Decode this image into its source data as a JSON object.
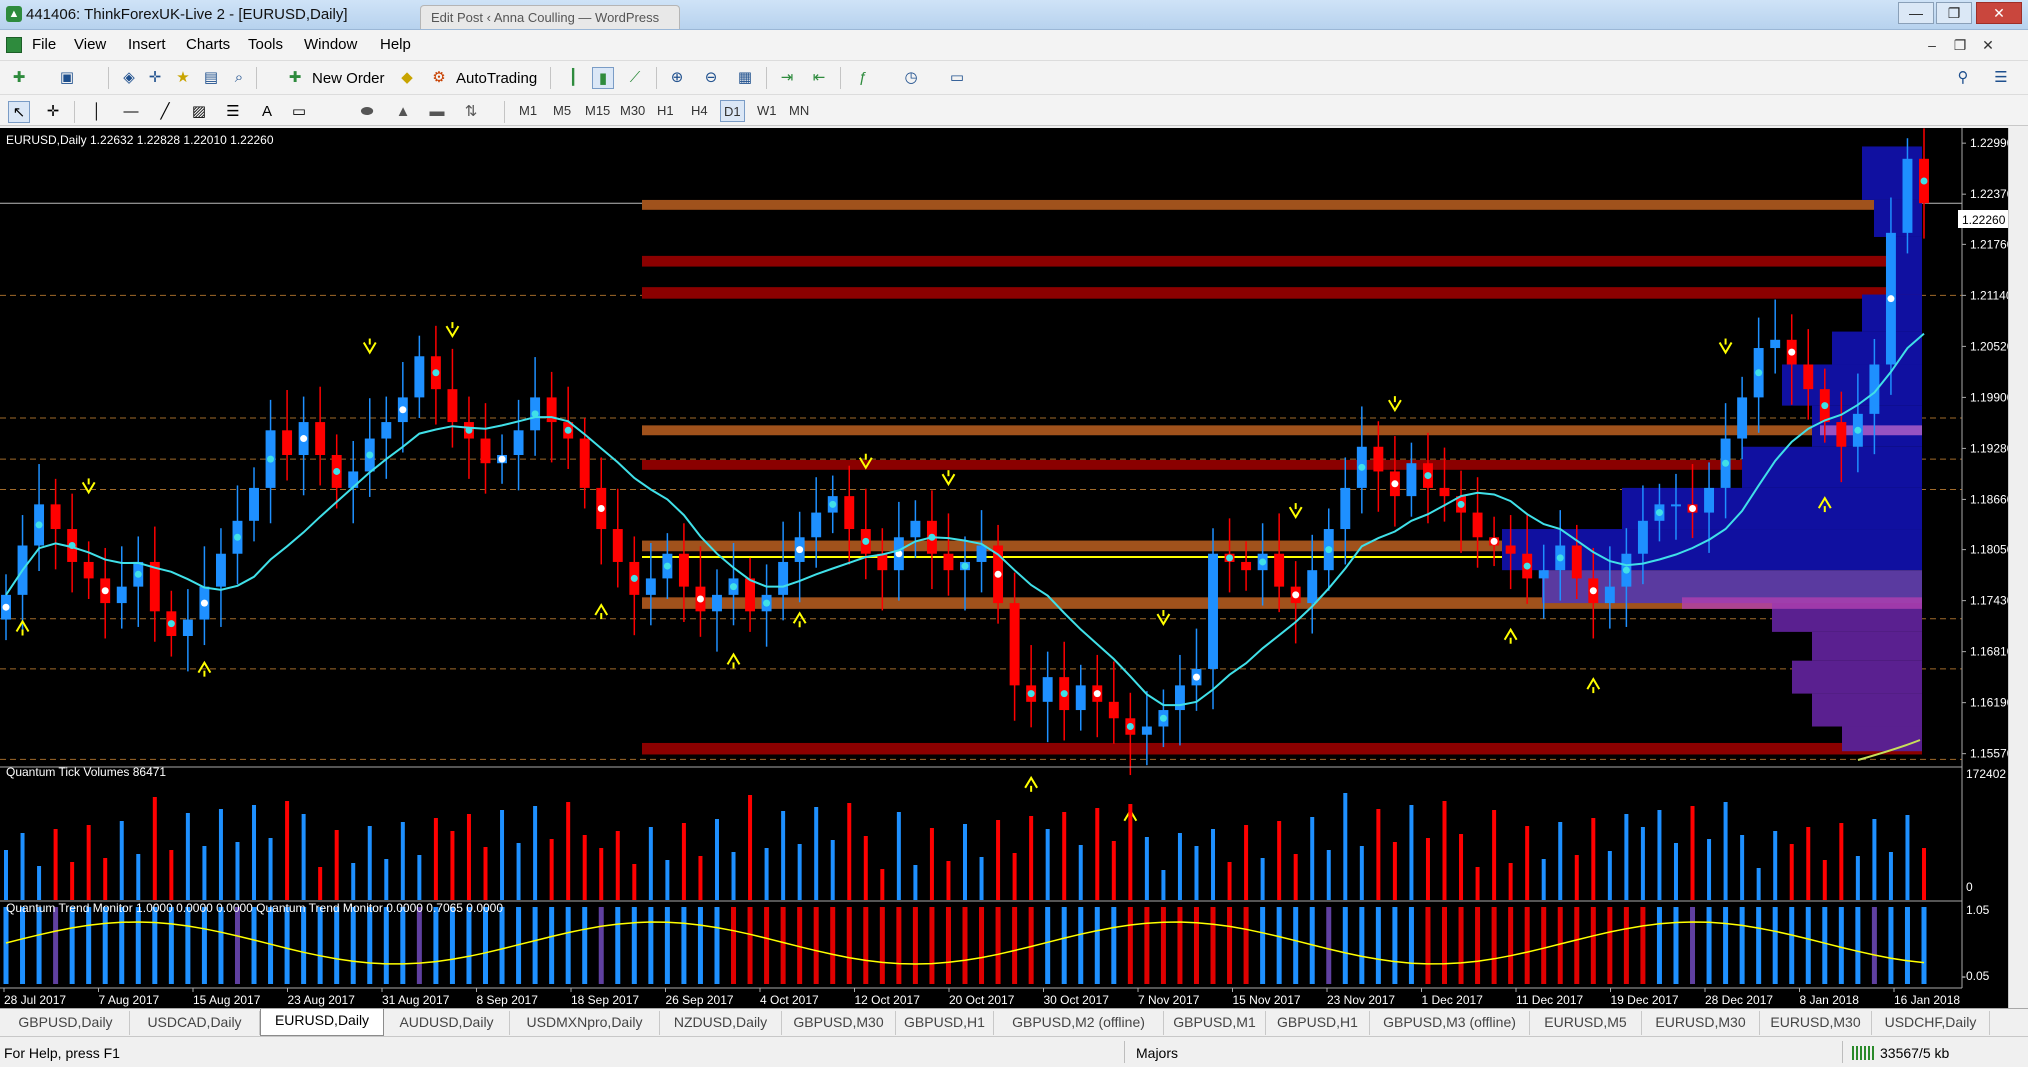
{
  "window": {
    "title": "441406: ThinkForexUK-Live 2 - [EURUSD,Daily]",
    "browser_tab_label": "Edit Post ‹ Anna Coulling — WordPress",
    "colors": {
      "titlebar": "#c4dbf2",
      "close": "#c9463d"
    }
  },
  "menu": {
    "items": [
      "File",
      "View",
      "Insert",
      "Charts",
      "Tools",
      "Window",
      "Help"
    ]
  },
  "toolbar": {
    "new_order_label": "New Order",
    "autotrading_label": "AutoTrading",
    "timeframes": [
      "M1",
      "M5",
      "M15",
      "M30",
      "H1",
      "H4",
      "D1",
      "W1",
      "MN"
    ],
    "active_timeframe": "D1"
  },
  "chart": {
    "header": "EURUSD,Daily  1.22632 1.22828 1.22010 1.22260",
    "current_price_label": "1.22260",
    "price_ticks": [
      "1.22990",
      "1.22370",
      "1.21760",
      "1.21140",
      "1.20520",
      "1.19900",
      "1.19280",
      "1.18660",
      "1.18050",
      "1.17430",
      "1.16810",
      "1.16190",
      "1.15570"
    ],
    "date_ticks": [
      "28 Jul 2017",
      "7 Aug 2017",
      "15 Aug 2017",
      "23 Aug 2017",
      "31 Aug 2017",
      "8 Sep 2017",
      "18 Sep 2017",
      "26 Sep 2017",
      "4 Oct 2017",
      "12 Oct 2017",
      "20 Oct 2017",
      "30 Oct 2017",
      "7 Nov 2017",
      "15 Nov 2017",
      "23 Nov 2017",
      "1 Dec 2017",
      "11 Dec 2017",
      "19 Dec 2017",
      "28 Dec 2017",
      "8 Jan 2018",
      "16 Jan 2018"
    ],
    "volume_pane": {
      "label": "Quantum Tick Volumes 86471",
      "max_label": "172402",
      "min_label": "0"
    },
    "trend_pane": {
      "label": "Quantum Trend Monitor 1.0000 0.0000 0.0000  Quantum Trend Monitor 0.0000 0.7065 0.0000",
      "max_label": "1.05",
      "min_label": "-0.05"
    },
    "colors": {
      "bull": "#1e90ff",
      "bear": "#ff0000",
      "ma": "#40e0e8",
      "yellow": "#ffff00",
      "orange_zone": "#a0521c",
      "red_zone": "#8b0000",
      "profile": "#1010a0"
    }
  },
  "tabs": {
    "items": [
      "GBPUSD,Daily",
      "USDCAD,Daily",
      "EURUSD,Daily",
      "AUDUSD,Daily",
      "USDMXNpro,Daily",
      "NZDUSD,Daily",
      "GBPUSD,M30",
      "GBPUSD,H1",
      "GBPUSD,M2 (offline)",
      "GBPUSD,M1",
      "GBPUSD,H1",
      "GBPUSD,M3 (offline)",
      "EURUSD,M5",
      "EURUSD,M30",
      "EURUSD,M30",
      "USDCHF,Daily"
    ],
    "active": "EURUSD,Daily"
  },
  "status": {
    "help": "For Help, press F1",
    "profile": "Majors",
    "traffic": "33567/5 kb"
  }
}
